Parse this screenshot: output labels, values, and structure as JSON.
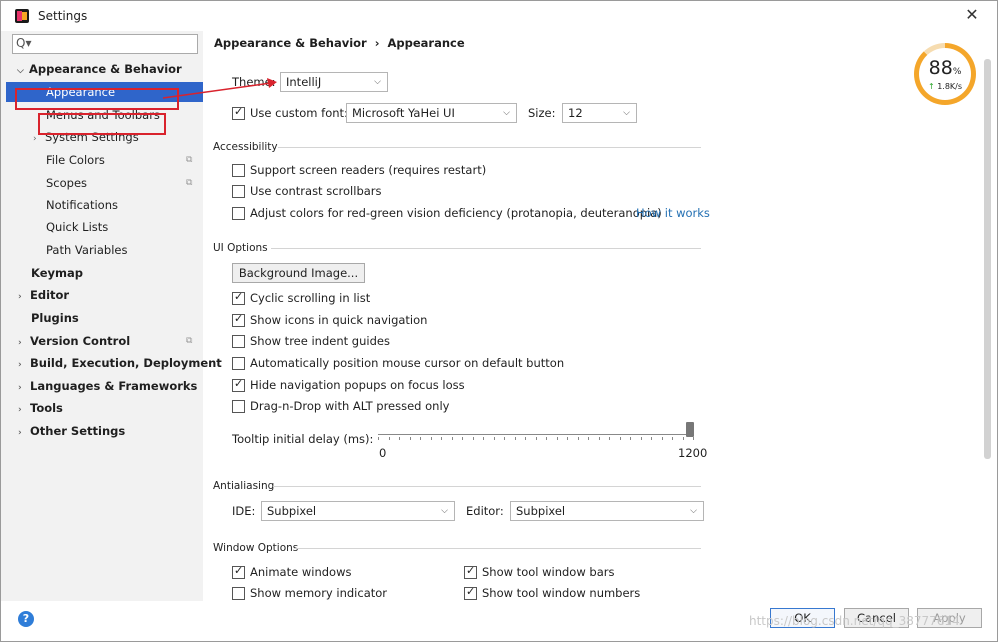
{
  "window": {
    "title": "Settings",
    "close_icon": "close-icon"
  },
  "sidebar": {
    "search_placeholder": "Q▾",
    "items": [
      {
        "label": "Appearance & Behavior",
        "level": 0,
        "bold": true,
        "expanded": true
      },
      {
        "label": "Appearance",
        "level": 1,
        "selected": true
      },
      {
        "label": "Menus and Toolbars",
        "level": 1
      },
      {
        "label": "System Settings",
        "level": 1,
        "arrow": true
      },
      {
        "label": "File Colors",
        "level": 1,
        "copy": true
      },
      {
        "label": "Scopes",
        "level": 1,
        "copy": true
      },
      {
        "label": "Notifications",
        "level": 1
      },
      {
        "label": "Quick Lists",
        "level": 1
      },
      {
        "label": "Path Variables",
        "level": 1
      },
      {
        "label": "Keymap",
        "level": 0,
        "bold": true
      },
      {
        "label": "Editor",
        "level": 0,
        "bold": true,
        "arrow": true
      },
      {
        "label": "Plugins",
        "level": 0,
        "bold": true
      },
      {
        "label": "Version Control",
        "level": 0,
        "bold": true,
        "arrow": true,
        "copy": true
      },
      {
        "label": "Build, Execution, Deployment",
        "level": 0,
        "bold": true,
        "arrow": true
      },
      {
        "label": "Languages & Frameworks",
        "level": 0,
        "bold": true,
        "arrow": true
      },
      {
        "label": "Tools",
        "level": 0,
        "bold": true,
        "arrow": true
      },
      {
        "label": "Other Settings",
        "level": 0,
        "bold": true,
        "arrow": true
      }
    ]
  },
  "main": {
    "breadcrumb": {
      "parent": "Appearance & Behavior",
      "separator": "›",
      "current": "Appearance"
    },
    "theme": {
      "label": "Theme:",
      "value": "IntelliJ"
    },
    "custom_font": {
      "label": "Use custom font:",
      "checked": true,
      "value": "Microsoft YaHei UI",
      "size_label": "Size:",
      "size_value": "12"
    },
    "accessibility": {
      "title": "Accessibility",
      "options": [
        {
          "label": "Support screen readers (requires restart)",
          "checked": false
        },
        {
          "label": "Use contrast scrollbars",
          "checked": false
        },
        {
          "label": "Adjust colors for red-green vision deficiency (protanopia, deuteranopia)",
          "checked": false,
          "link": "How it works"
        }
      ]
    },
    "ui_options": {
      "title": "UI Options",
      "background_button": "Background Image...",
      "options": [
        {
          "label": "Cyclic scrolling in list",
          "checked": true
        },
        {
          "label": "Show icons in quick navigation",
          "checked": true
        },
        {
          "label": "Show tree indent guides",
          "checked": false
        },
        {
          "label": "Automatically position mouse cursor on default button",
          "checked": false
        },
        {
          "label": "Hide navigation popups on focus loss",
          "checked": true
        },
        {
          "label": "Drag-n-Drop with ALT pressed only",
          "checked": false
        }
      ],
      "tooltip": {
        "label": "Tooltip initial delay (ms):",
        "min": "0",
        "max": "1200",
        "value": 1200
      }
    },
    "antialiasing": {
      "title": "Antialiasing",
      "ide_label": "IDE:",
      "ide_value": "Subpixel",
      "editor_label": "Editor:",
      "editor_value": "Subpixel"
    },
    "window_options": {
      "title": "Window Options",
      "left": [
        {
          "label": "Animate windows",
          "checked": true
        },
        {
          "label": "Show memory indicator",
          "checked": false
        }
      ],
      "right": [
        {
          "label": "Show tool window bars",
          "checked": true
        },
        {
          "label": "Show tool window numbers",
          "checked": true
        }
      ]
    }
  },
  "footer": {
    "ok": "OK",
    "cancel": "Cancel",
    "apply": "Apply",
    "help_icon": "help-icon"
  },
  "overlay": {
    "percent": "88",
    "percent_sign": "%",
    "speed_arrow": "↑",
    "speed": "1.8K/s",
    "progress": 0.88
  },
  "watermark": "https://blog.csdn.net/qq_38777614",
  "colors": {
    "selection": "#2f65ca",
    "highlight_box": "#d9232d",
    "link": "#2470b3",
    "gauge": "#f4a62a"
  }
}
